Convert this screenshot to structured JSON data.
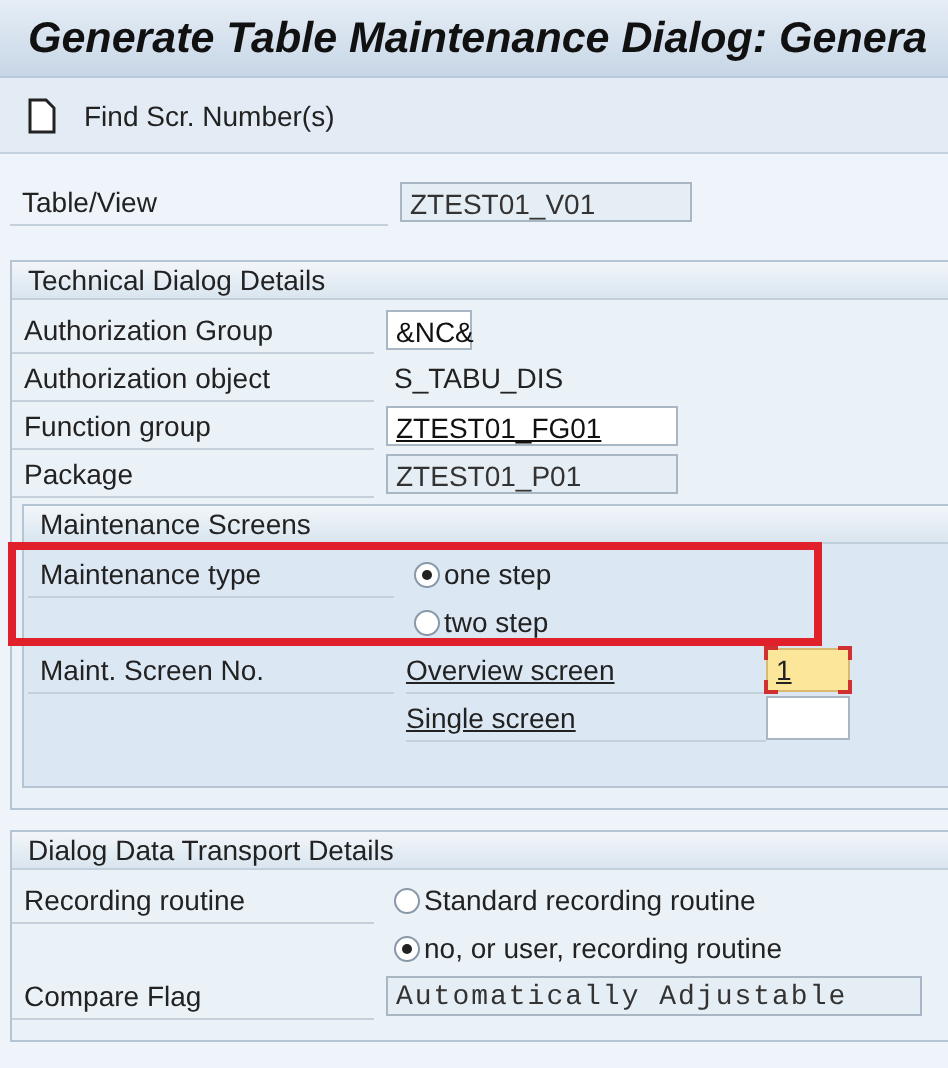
{
  "window": {
    "title": "Generate Table Maintenance Dialog: Genera"
  },
  "toolbar": {
    "buttons": [
      {
        "label": "Find Scr. Number(s)"
      }
    ]
  },
  "table_view": {
    "label": "Table/View",
    "value": "ZTEST01_V01",
    "editable": false
  },
  "sections": [
    {
      "title": "Technical Dialog Details",
      "rows": [
        {
          "kind": "short_field",
          "label": "Authorization Group",
          "value": "&NC&",
          "editable": true
        },
        {
          "kind": "text",
          "label": "Authorization object",
          "value": "S_TABU_DIS"
        },
        {
          "kind": "field",
          "label": "Function group",
          "value": "ZTEST01_FG01",
          "editable": true,
          "underlined": true
        },
        {
          "kind": "field",
          "label": "Package",
          "value": "ZTEST01_P01",
          "editable": false
        }
      ],
      "subsections": [
        {
          "title": "Maintenance Screens",
          "rows": [
            {
              "kind": "radio",
              "label": "Maintenance type",
              "option": "one step",
              "selected": true,
              "highlighted": true
            },
            {
              "kind": "radio",
              "option": "two step",
              "selected": false,
              "highlighted": true
            },
            {
              "kind": "screen",
              "label": "Maint. Screen No.",
              "link": "Overview screen",
              "value": "1",
              "focused": true
            },
            {
              "kind": "screen",
              "link": "Single screen",
              "focused": false
            }
          ]
        }
      ]
    },
    {
      "title": "Dialog Data Transport Details",
      "rows": [
        {
          "kind": "radio",
          "label": "Recording routine",
          "option": "Standard recording routine",
          "selected": false
        },
        {
          "kind": "radio",
          "option": "no, or user, recording routine",
          "selected": true
        },
        {
          "kind": "wide_field",
          "label": "Compare Flag",
          "value": "Automatically Adjustable",
          "editable": false
        }
      ]
    }
  ]
}
